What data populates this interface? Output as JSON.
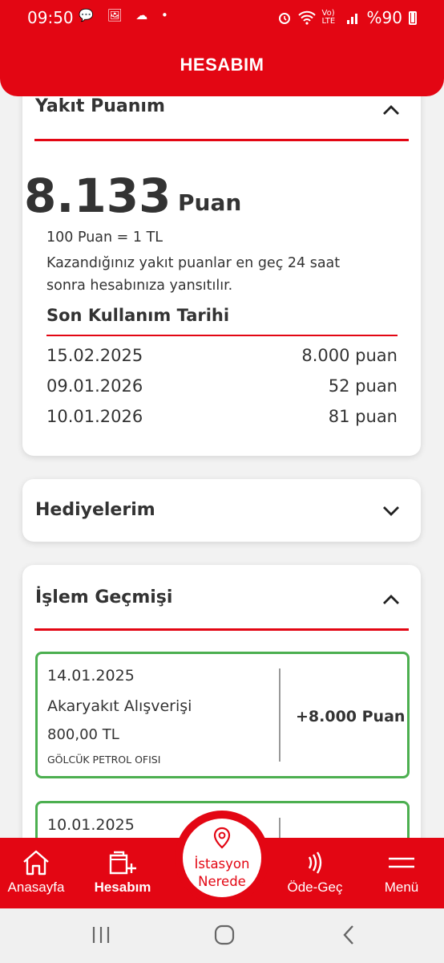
{
  "status_bar": {
    "time": "09:50",
    "left_icons": "💬 🖼 ☁ •",
    "network": "Vo) LTE",
    "battery": "%90"
  },
  "header": {
    "title": "HESABIM"
  },
  "fuel_points": {
    "title": "Yakıt Puanım",
    "points": "8.133",
    "unit": "Puan",
    "rate": "100 Puan = 1 TL",
    "info_line1": "Kazandığınız yakıt puanlar en geç 24 saat",
    "info_line2": "sonra hesabınıza yansıtılır.",
    "expiry_title": "Son Kullanım Tarihi",
    "expiry_rows": [
      {
        "date": "15.02.2025",
        "amount": "8.000 puan"
      },
      {
        "date": "09.01.2026",
        "amount": "52 puan"
      },
      {
        "date": "10.01.2026",
        "amount": "81 puan"
      }
    ]
  },
  "gifts": {
    "title": "Hediyelerim"
  },
  "history": {
    "title": "İşlem Geçmişi",
    "transactions": [
      {
        "date": "14.01.2025",
        "type": "Akaryakıt Alışverişi",
        "amount": "800,00 TL",
        "station": "GÖLCÜK PETROL OFISI",
        "points": "+8.000 Puan"
      },
      {
        "date": "10.01.2025"
      }
    ]
  },
  "bottom_nav": {
    "home": "Anasayfa",
    "account": "Hesabım",
    "station_line1": "İstasyon",
    "station_line2": "Nerede",
    "pay": "Öde-Geç",
    "menu": "Menü"
  },
  "colors": {
    "brand_red": "#e30613",
    "success_green": "#4caf50"
  }
}
